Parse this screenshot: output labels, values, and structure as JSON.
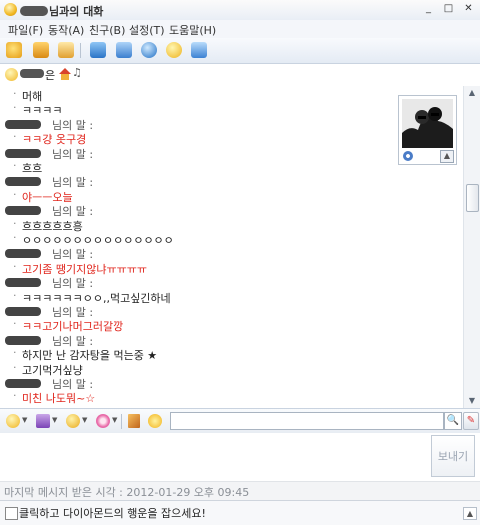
{
  "window": {
    "title_suffix": "님과의 대화",
    "min": "_",
    "max": "□",
    "close": "✕"
  },
  "menu": [
    "파일(F)",
    "동작(A)",
    "친구(B)",
    "설정(T)",
    "도움말(H)"
  ],
  "status": {
    "suffix": "은",
    "note": "♫"
  },
  "chat": {
    "speaker_label": "님의 말 :",
    "lines": [
      {
        "kind": "line",
        "text": "머해",
        "red": false
      },
      {
        "kind": "line",
        "text": "ㅋㅋㅋㅋ",
        "red": false
      },
      {
        "kind": "speaker"
      },
      {
        "kind": "line",
        "text": "ㅋㅋ걍 옷구경",
        "red": true
      },
      {
        "kind": "speaker"
      },
      {
        "kind": "line",
        "text": "흐흐",
        "red": false
      },
      {
        "kind": "speaker"
      },
      {
        "kind": "line",
        "text": "야ㅡㅡ오늘",
        "red": true
      },
      {
        "kind": "speaker"
      },
      {
        "kind": "line",
        "text": "흐흐흐흐흐흥",
        "red": false
      },
      {
        "kind": "line",
        "text": "ㅇㅇㅇㅇㅇㅇㅇㅇㅇㅇㅇㅇㅇㅇㅇ",
        "red": false
      },
      {
        "kind": "speaker"
      },
      {
        "kind": "line",
        "text": "고기좀 땡기지않냐ㅠㅠㅠㅠ",
        "red": true
      },
      {
        "kind": "speaker"
      },
      {
        "kind": "line",
        "text": "ㅋㅋㅋㅋㅋㅋㅇㅇ,,먹고싶긴하네",
        "red": false
      },
      {
        "kind": "speaker"
      },
      {
        "kind": "line",
        "text": "ㅋㅋ고기나머그러갈깡",
        "red": true
      },
      {
        "kind": "speaker"
      },
      {
        "kind": "line",
        "text": "하지만 난 감자탕을 먹는중 ★",
        "red": false
      },
      {
        "kind": "line",
        "text": "고기먹거싶냥",
        "red": false
      },
      {
        "kind": "speaker"
      },
      {
        "kind": "line",
        "text": "미친 나도뭐~☆",
        "red": true
      }
    ]
  },
  "input": {
    "search_value": "",
    "search_icon": "🔍",
    "side_icon": "✎"
  },
  "compose": {
    "send_label": "보내기"
  },
  "footer": {
    "last_message": "마지막 메시지 받은 시각 : 2012-01-29 오후 09:45"
  },
  "banner": {
    "text": "클릭하고 다이아몬드의 행운을 잡으세요!",
    "arrow": "▲"
  },
  "icons": {
    "toolbar": [
      "add-friend-icon",
      "send-file-icon",
      "invite-icon",
      "photo-icon",
      "screen-icon",
      "globe-icon",
      "emoticon-icon",
      "search-friend-icon"
    ],
    "inputbar": [
      "smiley-icon",
      "gift-icon",
      "face-icon",
      "flower-icon",
      "pen-icon",
      "star-icon"
    ]
  }
}
